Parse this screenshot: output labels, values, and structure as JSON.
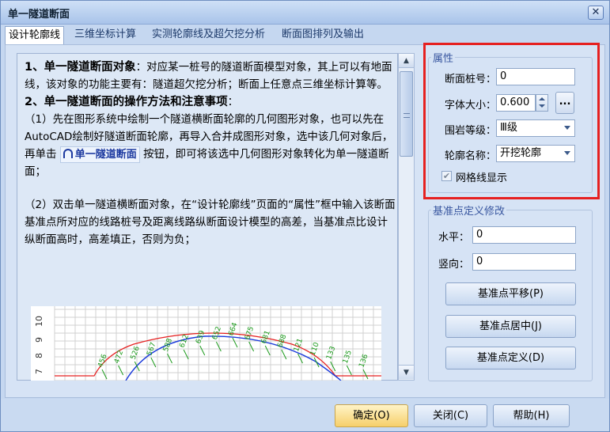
{
  "window": {
    "title": "单一隧道断面",
    "close_label": "✕"
  },
  "tabs": [
    {
      "label": "设计轮廓线"
    },
    {
      "label": "三维坐标计算"
    },
    {
      "label": "实测轮廓线及超欠挖分析"
    },
    {
      "label": "断面图排列及输出"
    }
  ],
  "doc": {
    "p1_bold": "1、单一隧道断面对象",
    "p1_rest": "：对应某一桩号的隧道断面模型对象，其上可以有地面线，该对象的功能主要有：隧道超欠挖分析；断面上任意点三维坐标计算等。",
    "p2_bold": "2、单一隧道断面的操作方法和注意事项",
    "p2_rest": "：",
    "p3_a": "（1）先在图形系统中绘制一个隧道横断面轮廓的几何图形对象，也可以先在AutoCAD绘制好隧道断面轮廓，再导入合并成图形对象，选中该几何对象后，再单击",
    "p3_btn": "单一隧道断面",
    "p3_b": "按钮，即可将该选中几何图形对象转化为单一隧道断面；",
    "p4": "（2）双击单一隧道横断面对象，在“设计轮廓线”页面的“属性”框中输入该断面基准点所对应的线路桩号及距离线路纵断面设计模型的高差，当基准点比设计纵断面高时，高差填正，否则为负；"
  },
  "chart_data": {
    "type": "line",
    "y_ticks": [
      "10",
      "9",
      "8",
      "7"
    ],
    "x_tick_labels": [
      "456",
      "472",
      "526",
      "567",
      "588",
      "612",
      "639",
      "652",
      "664",
      "675",
      "681",
      "688",
      "121",
      "110",
      "133",
      "135",
      "136"
    ]
  },
  "props": {
    "title": "属性",
    "station_label": "断面桩号：",
    "station_value": "0",
    "font_label": "字体大小：",
    "font_value": "0.600",
    "dots_label": "...",
    "rock_label": "围岩等级：",
    "rock_value": "Ⅲ级",
    "profile_label": "轮廓名称：",
    "profile_value": "开挖轮廓",
    "grid_label": "网格线显示",
    "grid_check": "✔"
  },
  "basepoint": {
    "title": "基准点定义修改",
    "h_label": "水平：",
    "h_value": "0",
    "v_label": "竖向：",
    "v_value": "0",
    "move_label": "基准点平移(P)",
    "center_label": "基准点居中(J)",
    "define_label": "基准点定义(D)"
  },
  "footer": {
    "ok_label": "确定(O)",
    "close_label": "关闭(C)",
    "help_label": "帮助(H)"
  },
  "colors": {
    "highlight_box": "#e62020",
    "design_line": "#e62020",
    "arc_line": "#1a3adb",
    "label_green": "#1a9a1a"
  }
}
